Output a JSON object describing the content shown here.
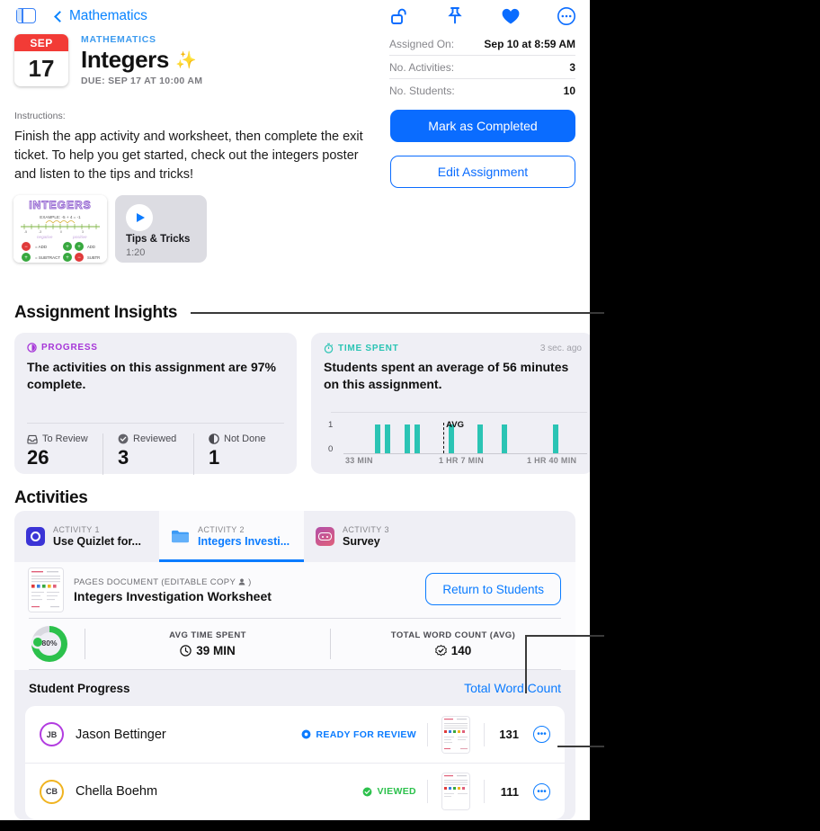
{
  "topbar": {
    "sidebar_toggle_icon": "sidebar-toggle-icon",
    "back_label": "Mathematics"
  },
  "header_icons": [
    {
      "name": "unlock-icon",
      "glyph": "unlock"
    },
    {
      "name": "pin-icon",
      "glyph": "pin"
    },
    {
      "name": "heart-icon",
      "glyph": "♥"
    },
    {
      "name": "more-options-icon",
      "glyph": "•••"
    }
  ],
  "assignment": {
    "date_month": "SEP",
    "date_day": "17",
    "subject": "MATHEMATICS",
    "title": "Integers",
    "title_emoji": "✨",
    "due": "DUE: SEP 17 AT 10:00 AM"
  },
  "meta": [
    {
      "key": "Assigned On:",
      "value": "Sep 10 at 8:59 AM"
    },
    {
      "key": "No. Activities:",
      "value": "3"
    },
    {
      "key": "No. Students:",
      "value": "10"
    }
  ],
  "actions": {
    "primary": "Mark as Completed",
    "secondary": "Edit Assignment"
  },
  "instructions": {
    "label": "Instructions:",
    "body": "Finish the app activity and worksheet, then complete the exit ticket. To help you get started, check out the integers poster and listen to the tips and tricks!"
  },
  "attachments": {
    "poster": {
      "name": "integers-poster-thumbnail",
      "heading": "INTEGERS",
      "example": "EXAMPLE: -5 + 4 = -1",
      "left_label": "negative",
      "right_label": "positive",
      "rows": [
        {
          "sign": "−",
          "text": "= ADD"
        },
        {
          "sign": "+",
          "text": "= SUBTRACT"
        }
      ]
    },
    "audio": {
      "title": "Tips & Tricks",
      "duration": "1:20",
      "play_icon": "play-icon"
    }
  },
  "insights": {
    "heading": "Assignment Insights",
    "progress_card": {
      "kicker": "PROGRESS",
      "kicker_color": "#a636d8",
      "kicker_icon": "progress-icon",
      "statement": "The activities on this assignment are 97% complete.",
      "stats": [
        {
          "label": "To Review",
          "value": "26",
          "icon": "inbox-icon"
        },
        {
          "label": "Reviewed",
          "value": "3",
          "icon": "check-circle-icon"
        },
        {
          "label": "Not Done",
          "value": "1",
          "icon": "half-circle-icon"
        }
      ]
    },
    "time_card": {
      "kicker": "TIME SPENT",
      "kicker_color": "#2bc4b4",
      "kicker_icon": "stopwatch-icon",
      "timestamp": "3 sec. ago",
      "statement": "Students spent an average of 56 minutes on this assignment."
    }
  },
  "chart_data": {
    "type": "bar",
    "title": "Time Spent",
    "xlabel": "",
    "ylabel": "",
    "ylim": [
      0,
      1
    ],
    "yticks": [
      "0",
      "1"
    ],
    "xticks": [
      "33 MIN",
      "1 HR 7 MIN",
      "1 HR 40 MIN"
    ],
    "xtick_positions_pct": [
      0,
      50,
      100
    ],
    "series_color": "#2bc4b4",
    "grid": false,
    "legend": "none",
    "annotation": {
      "label": "AVG",
      "position_pct": 41,
      "style": "dashed-vertical"
    },
    "bars": [
      {
        "x_pct": 13,
        "value": 1
      },
      {
        "x_pct": 17,
        "value": 1
      },
      {
        "x_pct": 25,
        "value": 1
      },
      {
        "x_pct": 29,
        "value": 1
      },
      {
        "x_pct": 43,
        "value": 1
      },
      {
        "x_pct": 55,
        "value": 1
      },
      {
        "x_pct": 65,
        "value": 1
      },
      {
        "x_pct": 86,
        "value": 1
      }
    ]
  },
  "activities": {
    "heading": "Activities",
    "tabs": [
      {
        "kicker": "ACTIVITY 1",
        "name": "Use Quizlet for...",
        "icon": "quizlet-app-icon",
        "icon_color": "#3b34d6",
        "active": false
      },
      {
        "kicker": "ACTIVITY 2",
        "name": "Integers Investi...",
        "icon": "folder-icon",
        "icon_color": "#3b9af5",
        "active": true
      },
      {
        "kicker": "ACTIVITY 3",
        "name": "Survey",
        "icon": "survey-app-icon",
        "icon_color": "#c2557d",
        "active": false
      }
    ],
    "document": {
      "kicker": "PAGES DOCUMENT (EDITABLE COPY",
      "kicker_icon": "person-icon",
      "kicker_suffix": ")",
      "name": "Integers Investigation Worksheet",
      "return_button": "Return to Students"
    },
    "metrics": {
      "ring_percent": "80%",
      "ring_value": 80,
      "items": [
        {
          "label": "AVG TIME SPENT",
          "value": "39 MIN",
          "icon": "clock-icon"
        },
        {
          "label": "TOTAL WORD COUNT (AVG)",
          "value": "140",
          "icon": "badge-check-icon"
        }
      ]
    },
    "student_progress": {
      "title": "Student Progress",
      "sort_link": "Total Word Count",
      "rows": [
        {
          "initials": "JB",
          "name": "Jason Bettinger",
          "ring_color": "#b23ce0",
          "status": "READY FOR REVIEW",
          "status_color": "#0a7bff",
          "status_icon": "ready-dot-icon",
          "count": "131",
          "more_icon": "more-options-icon"
        },
        {
          "initials": "CB",
          "name": "Chella Boehm",
          "ring_color": "#f0b320",
          "status": "VIEWED",
          "status_color": "#2cc14c",
          "status_icon": "check-circle-icon",
          "count": "111",
          "more_icon": "more-options-icon"
        }
      ]
    }
  }
}
